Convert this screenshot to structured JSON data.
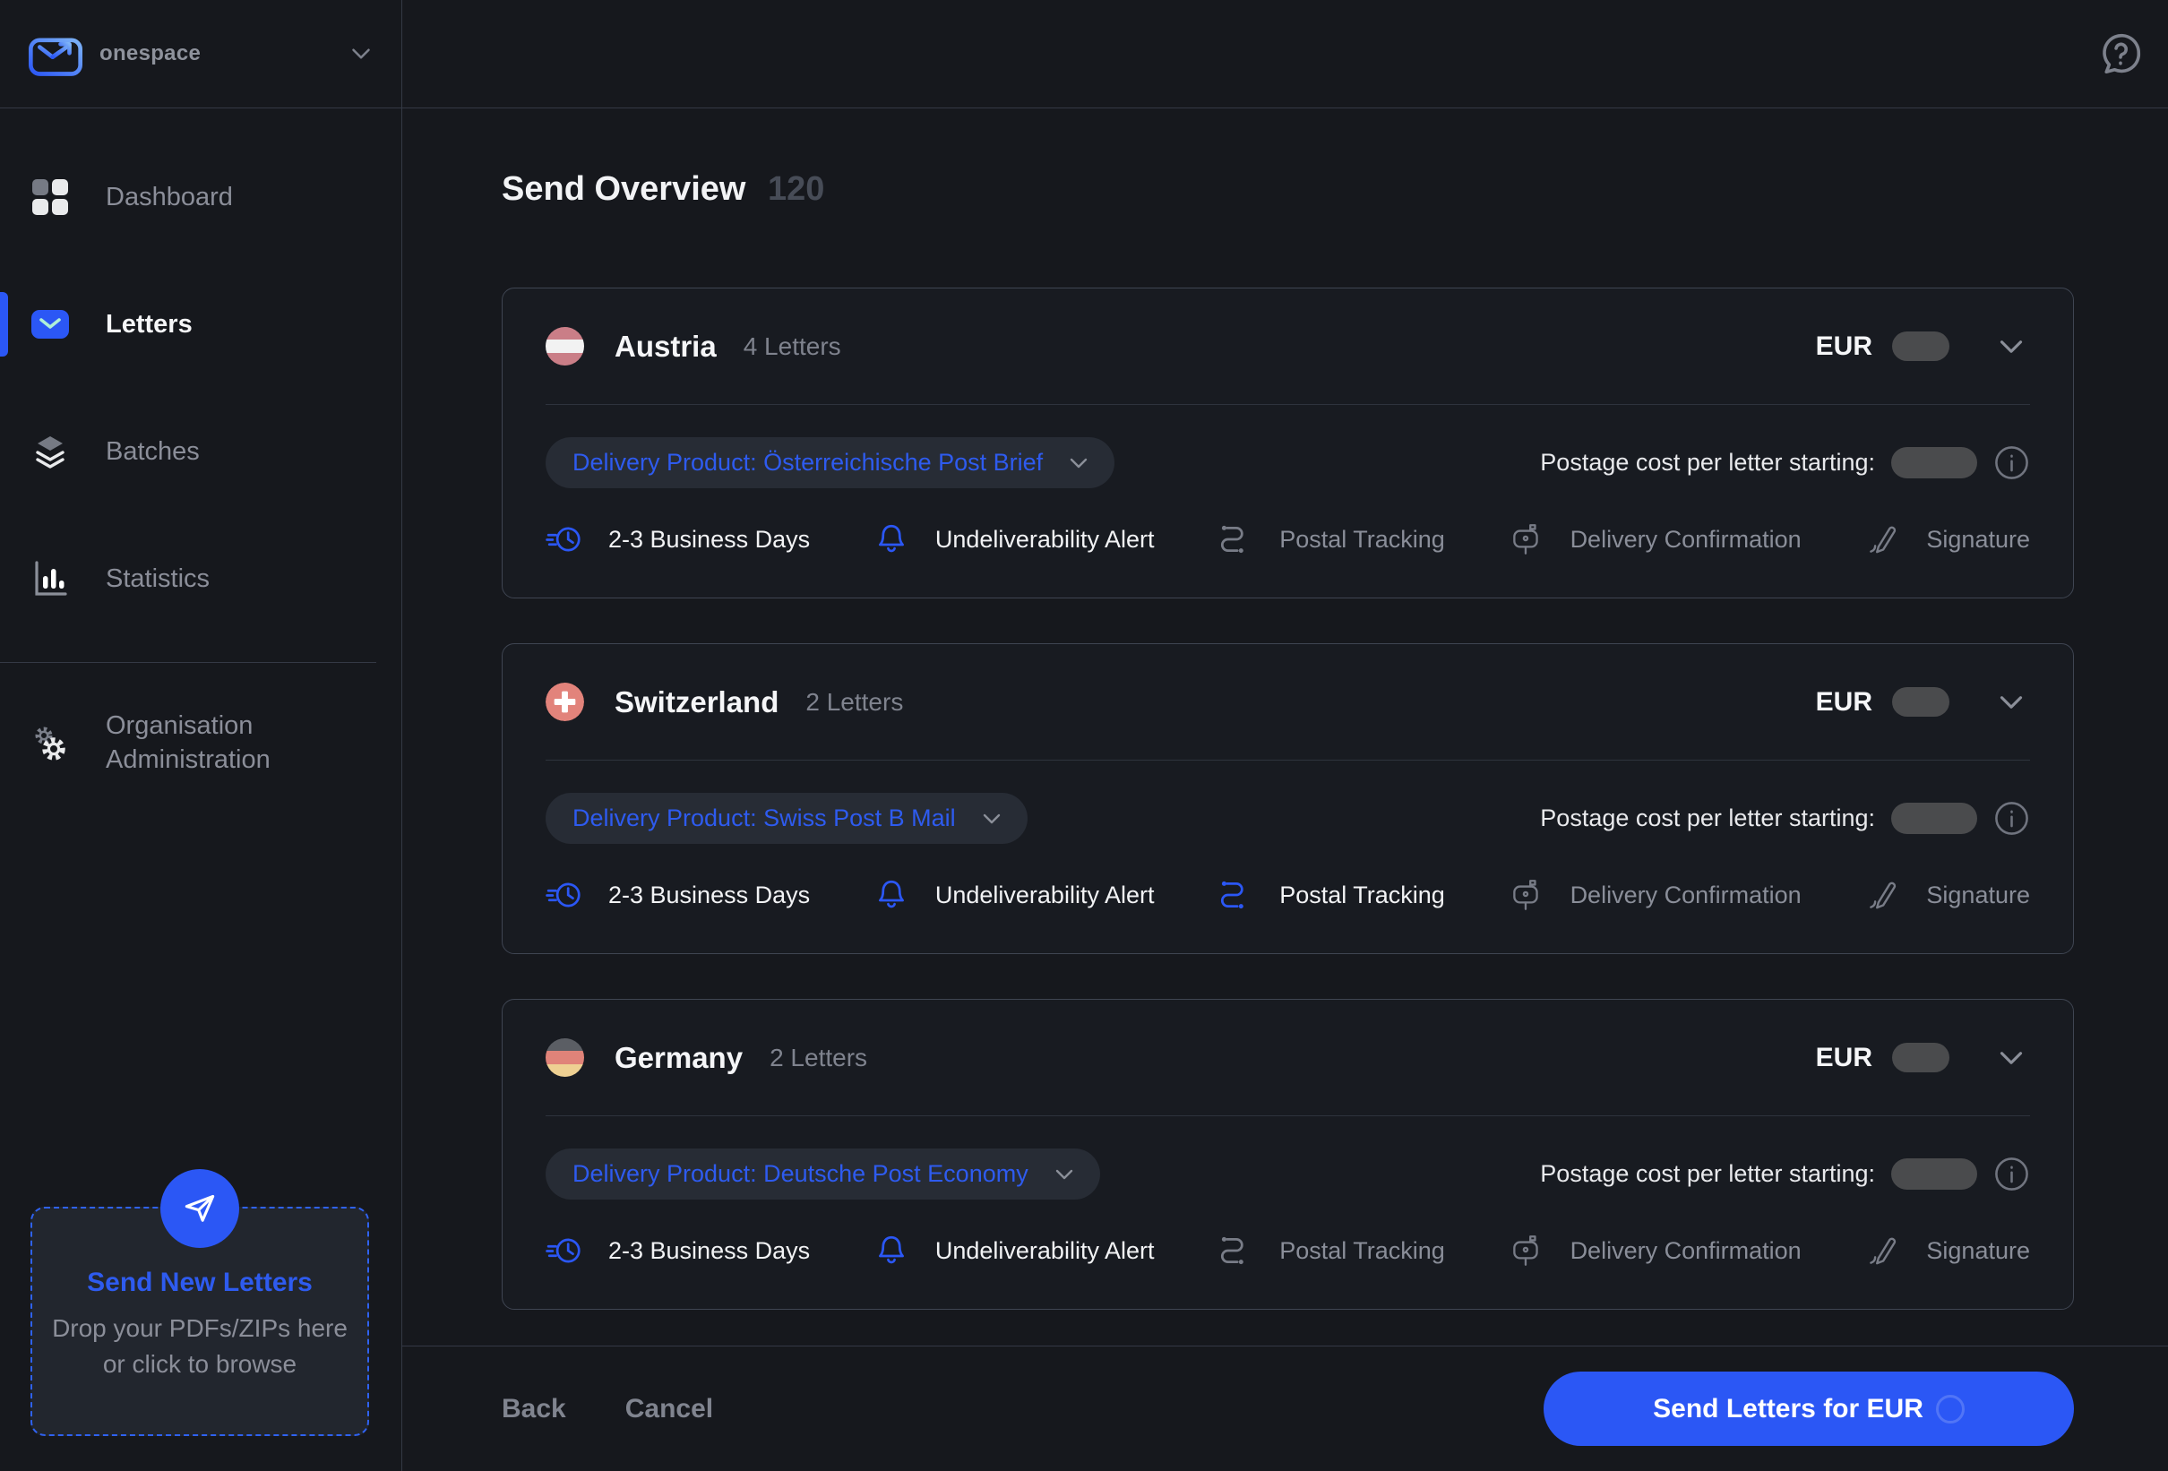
{
  "brand": {
    "name": "onespace"
  },
  "header": {
    "title": "Send Overview",
    "count": "120"
  },
  "sidebar": {
    "items": [
      {
        "label": "Dashboard",
        "icon": "dashboard-icon",
        "active": false,
        "section": "main"
      },
      {
        "label": "Letters",
        "icon": "letters-icon",
        "active": true,
        "section": "main"
      },
      {
        "label": "Batches",
        "icon": "batches-icon",
        "active": false,
        "section": "main"
      },
      {
        "label": "Statistics",
        "icon": "statistics-icon",
        "active": false,
        "section": "main"
      },
      {
        "label": "Organisation Administration",
        "icon": "gears-icon",
        "active": false,
        "section": "admin"
      }
    ],
    "dropzone": {
      "title": "Send New Letters",
      "subtitle": "Drop your PDFs/ZIPs here or click to browse"
    }
  },
  "cards": [
    {
      "country": "Austria",
      "flag": "austria",
      "letters": "4 Letters",
      "currency": "EUR",
      "product_label": "Delivery Product: Österreichische Post Brief",
      "postage_label": "Postage cost per letter starting:",
      "features": [
        {
          "label": "2-3 Business Days",
          "icon": "clock-speed-icon",
          "active": true
        },
        {
          "label": "Undeliverability Alert",
          "icon": "bell-icon",
          "active": true
        },
        {
          "label": "Postal Tracking",
          "icon": "route-icon",
          "active": false
        },
        {
          "label": "Delivery Confirmation",
          "icon": "mailbox-icon",
          "active": false
        },
        {
          "label": "Signature",
          "icon": "pen-icon",
          "active": false
        }
      ]
    },
    {
      "country": "Switzerland",
      "flag": "switzerland",
      "letters": "2 Letters",
      "currency": "EUR",
      "product_label": "Delivery Product: Swiss Post B Mail",
      "postage_label": "Postage cost per letter starting:",
      "features": [
        {
          "label": "2-3 Business Days",
          "icon": "clock-speed-icon",
          "active": true
        },
        {
          "label": "Undeliverability Alert",
          "icon": "bell-icon",
          "active": true
        },
        {
          "label": "Postal Tracking",
          "icon": "route-icon",
          "active": true
        },
        {
          "label": "Delivery Confirmation",
          "icon": "mailbox-icon",
          "active": false
        },
        {
          "label": "Signature",
          "icon": "pen-icon",
          "active": false
        }
      ]
    },
    {
      "country": "Germany",
      "flag": "germany",
      "letters": "2 Letters",
      "currency": "EUR",
      "product_label": "Delivery Product: Deutsche Post Economy",
      "postage_label": "Postage cost per letter starting:",
      "features": [
        {
          "label": "2-3 Business Days",
          "icon": "clock-speed-icon",
          "active": true
        },
        {
          "label": "Undeliverability Alert",
          "icon": "bell-icon",
          "active": true
        },
        {
          "label": "Postal Tracking",
          "icon": "route-icon",
          "active": false
        },
        {
          "label": "Delivery Confirmation",
          "icon": "mailbox-icon",
          "active": false
        },
        {
          "label": "Signature",
          "icon": "pen-icon",
          "active": false
        }
      ]
    }
  ],
  "footer": {
    "back_label": "Back",
    "cancel_label": "Cancel",
    "send_label": "Send Letters for EUR"
  },
  "colors": {
    "accent_blue": "#2b57f5",
    "link_blue": "#2e5bef",
    "page_bg": "#16181d",
    "skeleton_gray": "#4a4b4d"
  }
}
